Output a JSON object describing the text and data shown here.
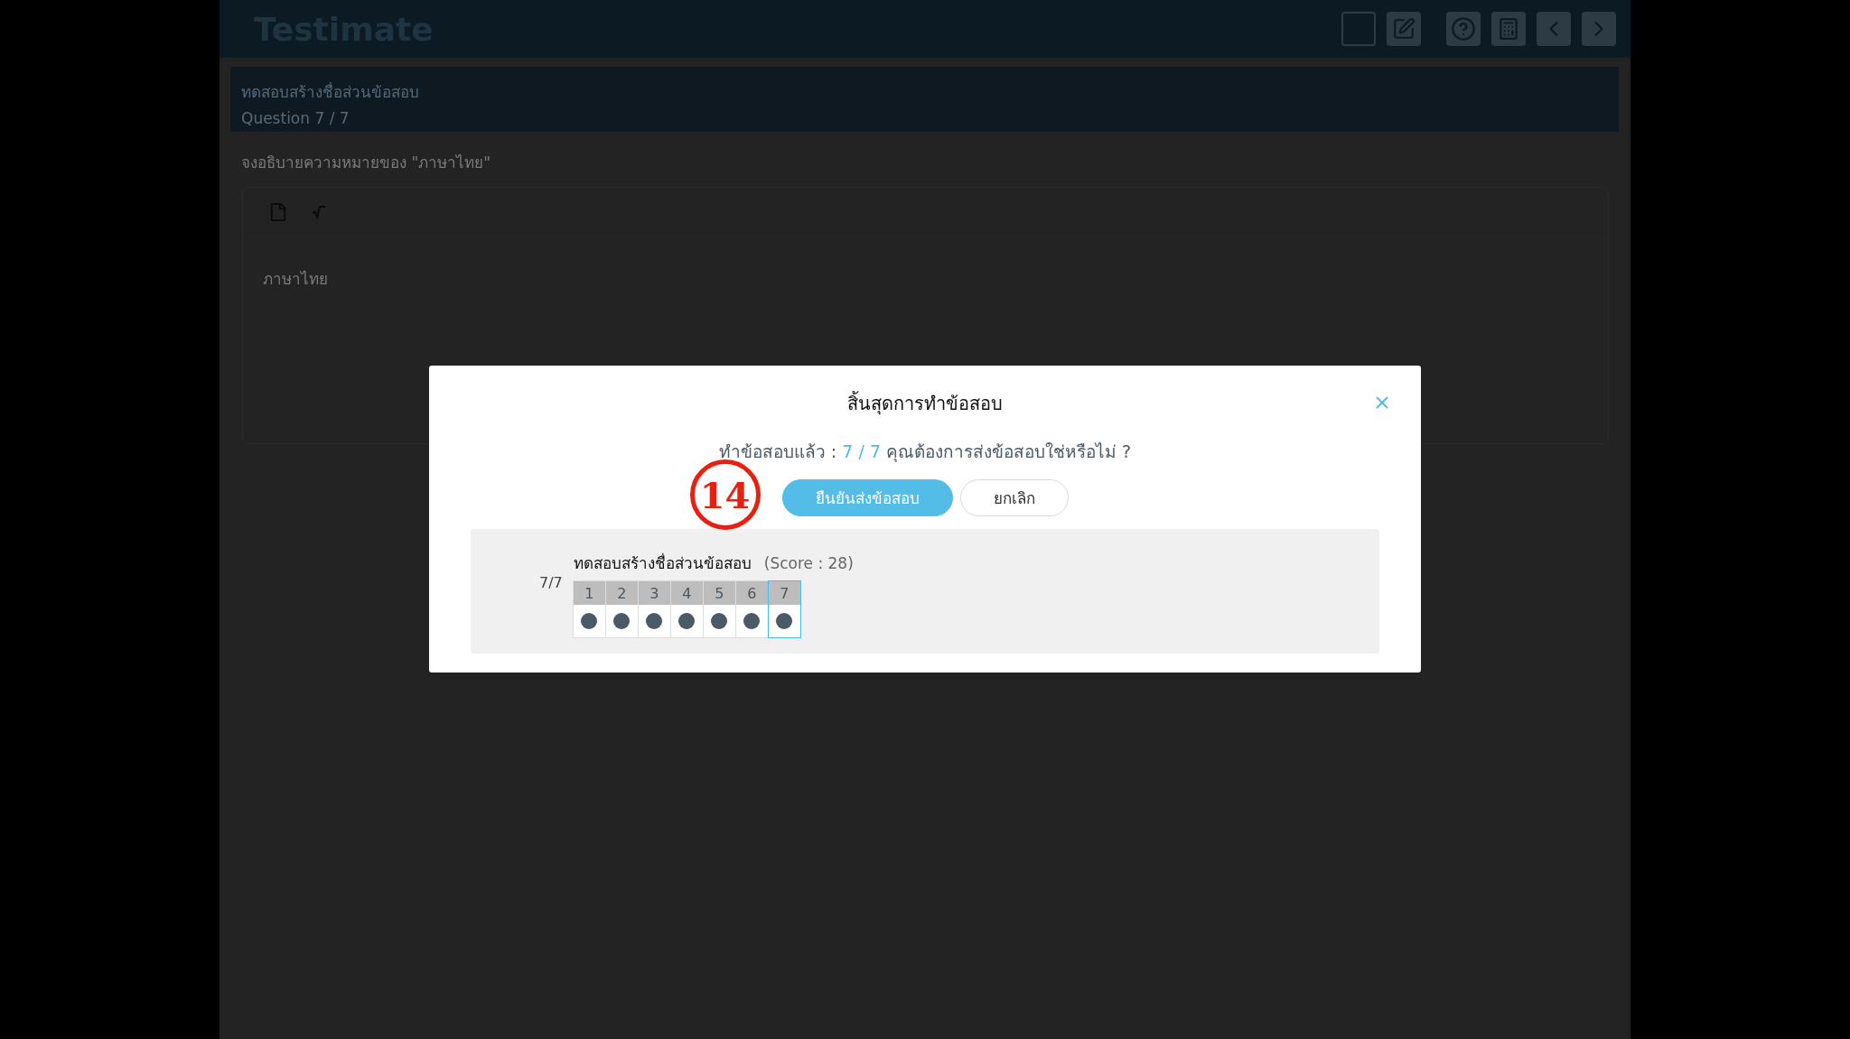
{
  "app": {
    "title": "Testimate"
  },
  "banner": {
    "title": "ทดสอบสร้างชื่อส่วนข้อสอบ",
    "subtitle": "Question 7 / 7"
  },
  "question": {
    "prompt": "จงอธิบายความหมายของ \"ภาษาไทย\"",
    "answer": "ภาษาไทย"
  },
  "dialog": {
    "title": "สิ้นสุดการทำข้อสอบ",
    "message_prefix": "ทำข้อสอบแล้ว :",
    "progress": "7 / 7",
    "message_suffix": "คุณต้องการส่งข้อสอบใช่หรือไม่ ?",
    "confirm": "ยืนยันส่งข้อสอบ",
    "cancel": "ยกเลิก",
    "step_badge": "14",
    "section": {
      "title": "ทดสอบสร้างชื่อส่วนข้อสอบ",
      "score": "(Score : 28)",
      "count": "7/7",
      "questions": [
        {
          "label": "1",
          "answered": true,
          "selected": false
        },
        {
          "label": "2",
          "answered": true,
          "selected": false
        },
        {
          "label": "3",
          "answered": true,
          "selected": false
        },
        {
          "label": "4",
          "answered": true,
          "selected": false
        },
        {
          "label": "5",
          "answered": true,
          "selected": false
        },
        {
          "label": "6",
          "answered": true,
          "selected": false
        },
        {
          "label": "7",
          "answered": true,
          "selected": true
        }
      ]
    }
  }
}
